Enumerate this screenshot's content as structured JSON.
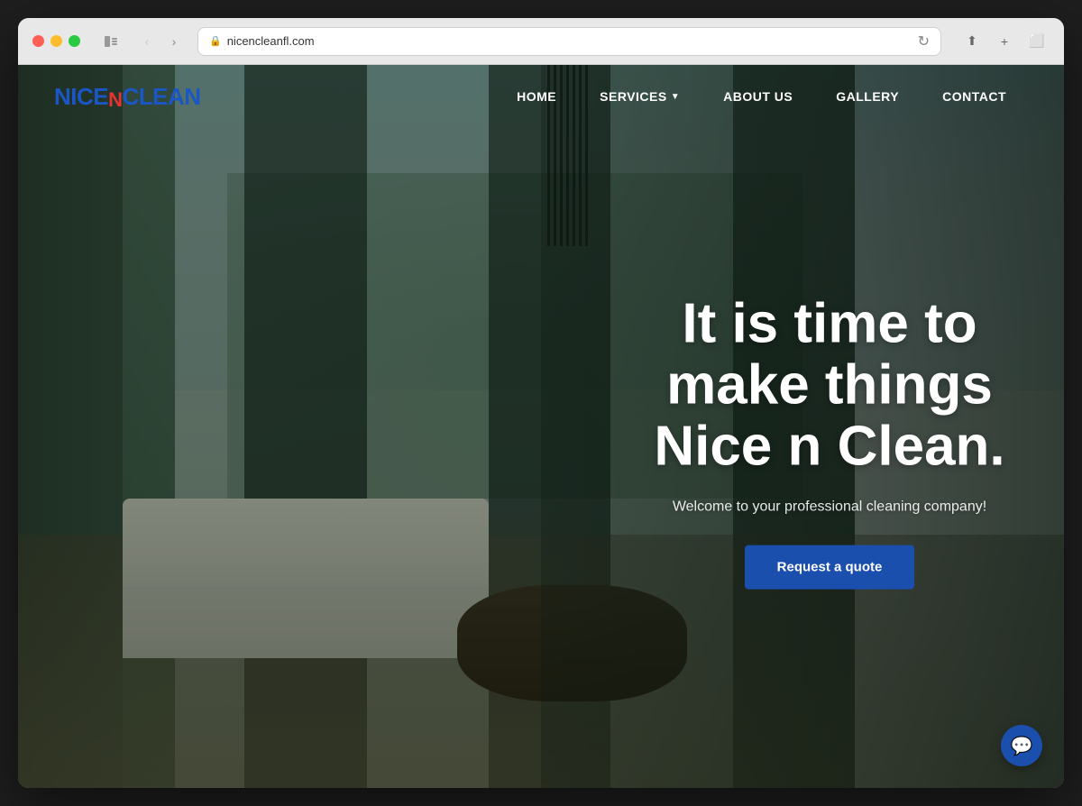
{
  "browser": {
    "url": "nicencleanfl.com",
    "title": "nicencleanfl.com"
  },
  "logo": {
    "part1": "NICE",
    "n_letter": "n",
    "part2": "CLEAN"
  },
  "nav": {
    "links": [
      {
        "id": "home",
        "label": "HOME",
        "hasDropdown": false
      },
      {
        "id": "services",
        "label": "SERVICES",
        "hasDropdown": true
      },
      {
        "id": "about",
        "label": "ABOUT US",
        "hasDropdown": false
      },
      {
        "id": "gallery",
        "label": "GALLERY",
        "hasDropdown": false
      },
      {
        "id": "contact",
        "label": "CONTACT",
        "hasDropdown": false
      }
    ]
  },
  "hero": {
    "headline": "It is time to make things Nice n Clean.",
    "subtitle": "Welcome to your professional cleaning company!",
    "cta_label": "Request a quote"
  },
  "chat": {
    "icon": "💬"
  }
}
